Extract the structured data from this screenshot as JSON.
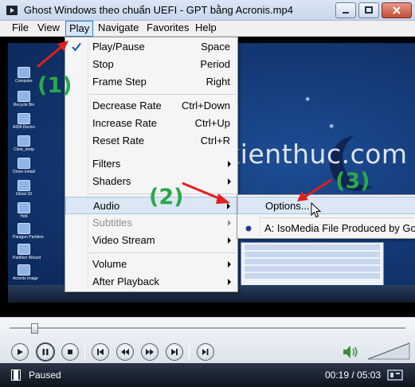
{
  "window": {
    "title": "Ghost Windows theo chuẩn UEFI - GPT bằng Acronis.mp4",
    "icon": "media-player-icon"
  },
  "menubar": {
    "items": [
      {
        "label": "File"
      },
      {
        "label": "View"
      },
      {
        "label": "Play"
      },
      {
        "label": "Navigate"
      },
      {
        "label": "Favorites"
      },
      {
        "label": "Help"
      }
    ]
  },
  "play_menu": {
    "items": [
      {
        "label": "Play/Pause",
        "shortcut": "Space",
        "checked": true
      },
      {
        "label": "Stop",
        "shortcut": "Period"
      },
      {
        "label": "Frame Step",
        "shortcut": "Right"
      },
      {
        "label": "Decrease Rate",
        "shortcut": "Ctrl+Down"
      },
      {
        "label": "Increase Rate",
        "shortcut": "Ctrl+Up"
      },
      {
        "label": "Reset Rate",
        "shortcut": "Ctrl+R"
      },
      {
        "label": "Filters",
        "submenu": true
      },
      {
        "label": "Shaders",
        "submenu": true
      },
      {
        "label": "Audio",
        "submenu": true
      },
      {
        "label": "Subtitles",
        "submenu": true,
        "disabled": true
      },
      {
        "label": "Video Stream",
        "submenu": true
      },
      {
        "label": "Volume",
        "submenu": true
      },
      {
        "label": "After Playback",
        "submenu": true
      }
    ]
  },
  "audio_submenu": {
    "items": [
      {
        "label": "Options..."
      },
      {
        "label": "A: IsoMedia File Produced by Googl",
        "radio": true
      }
    ]
  },
  "video": {
    "watermark": "blogchiasekienthuc.com",
    "desktop_icons": [
      "Computer",
      "Recycle Bin",
      "AIDA Device",
      "Clear_temp",
      "Driver Install",
      "Ghost 32",
      "Hdd",
      "Paragon Partition",
      "Partition Wizard",
      "Acronis Image"
    ]
  },
  "annotations": {
    "step1": "(1)",
    "step2": "(2)",
    "step3": "(3)"
  },
  "status": {
    "state": "Paused",
    "time": "00:19 / 05:03",
    "seek_fraction": 0.063
  },
  "colors": {
    "annotation_green": "#2aa84a",
    "arrow_red": "#e02020",
    "menu_highlight": "#dbe7f5"
  }
}
